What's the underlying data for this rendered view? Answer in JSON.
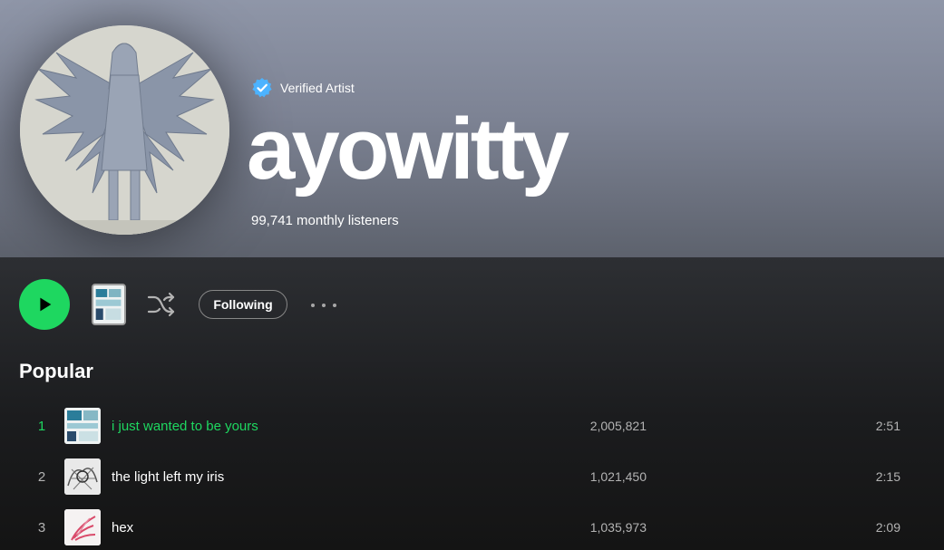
{
  "artist": {
    "verified_label": "Verified Artist",
    "name": "ayowitty",
    "monthly_listeners": "99,741 monthly listeners"
  },
  "actions": {
    "follow_label": "Following"
  },
  "popular": {
    "title": "Popular",
    "tracks": [
      {
        "number": "1",
        "title": "i just wanted to be yours",
        "plays": "2,005,821",
        "duration": "2:51",
        "playing": true
      },
      {
        "number": "2",
        "title": "the light left my iris",
        "plays": "1,021,450",
        "duration": "2:15",
        "playing": false
      },
      {
        "number": "3",
        "title": "hex",
        "plays": "1,035,973",
        "duration": "2:09",
        "playing": false
      }
    ]
  },
  "colors": {
    "accent": "#1ed760",
    "header_gradient_top": "#8f96a8",
    "header_gradient_bottom": "#5d626d",
    "background": "#121212",
    "secondary_text": "#b3b3b3",
    "verified_badge": "#4cb3ff"
  },
  "icons": {
    "verified": "verified-badge-icon",
    "play": "play-icon",
    "shuffle": "shuffle-icon",
    "more": "more-options-icon"
  }
}
